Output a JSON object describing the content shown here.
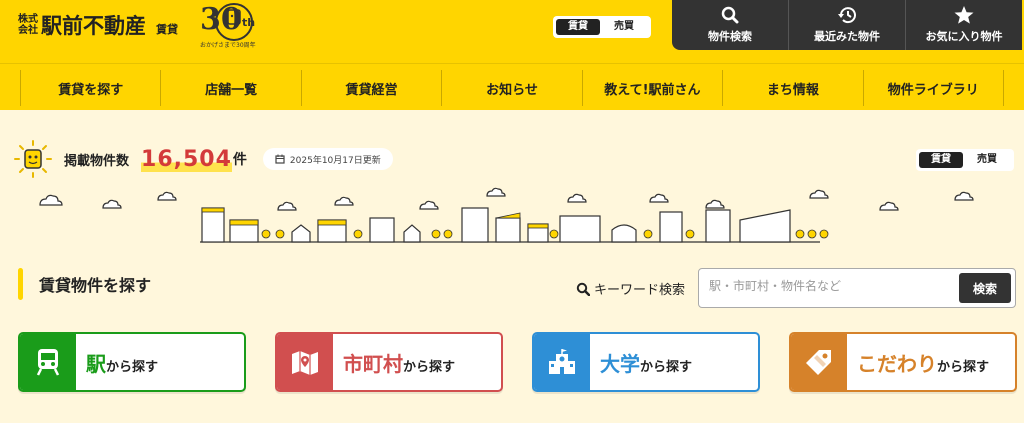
{
  "header": {
    "logo_kabu_1": "株式",
    "logo_kabu_2": "会社",
    "logo_name": "駅前不動産",
    "logo_type": "賃貸",
    "anniv_number": "30",
    "anniv_suffix": "th",
    "anniv_sub": "おかげさまで30周年"
  },
  "toggle_top": {
    "on": "賃貸",
    "off": "売買"
  },
  "utility": [
    {
      "label": "物件検索",
      "icon": "search-icon"
    },
    {
      "label": "最近みた物件",
      "icon": "history-icon"
    },
    {
      "label": "お気に入り物件",
      "icon": "star-icon"
    }
  ],
  "nav": [
    "賃貸を探す",
    "店舗一覧",
    "賃貸経営",
    "お知らせ",
    "教えて!駅前さん",
    "まち情報",
    "物件ライブラリ"
  ],
  "count": {
    "label": "掲載物件数",
    "number": "16,504",
    "unit": "件",
    "updated": "2025年10月17日更新"
  },
  "toggle_mid": {
    "on": "賃貸",
    "off": "売買"
  },
  "search": {
    "title": "賃貸物件を探す",
    "keyword_label": "キーワード検索",
    "placeholder": "駅・市町村・物件名など",
    "button": "検索"
  },
  "cards": [
    {
      "big": "駅",
      "small": "から探す",
      "color": "#1a9c1a",
      "icon": "train-icon"
    },
    {
      "big": "市町村",
      "small": "から探す",
      "color": "#d14f4f",
      "icon": "map-icon"
    },
    {
      "big": "大学",
      "small": "から探す",
      "color": "#2e8fd6",
      "icon": "school-icon"
    },
    {
      "big": "こだわり",
      "small": "から探す",
      "color": "#d6822a",
      "icon": "tag-icon"
    }
  ]
}
